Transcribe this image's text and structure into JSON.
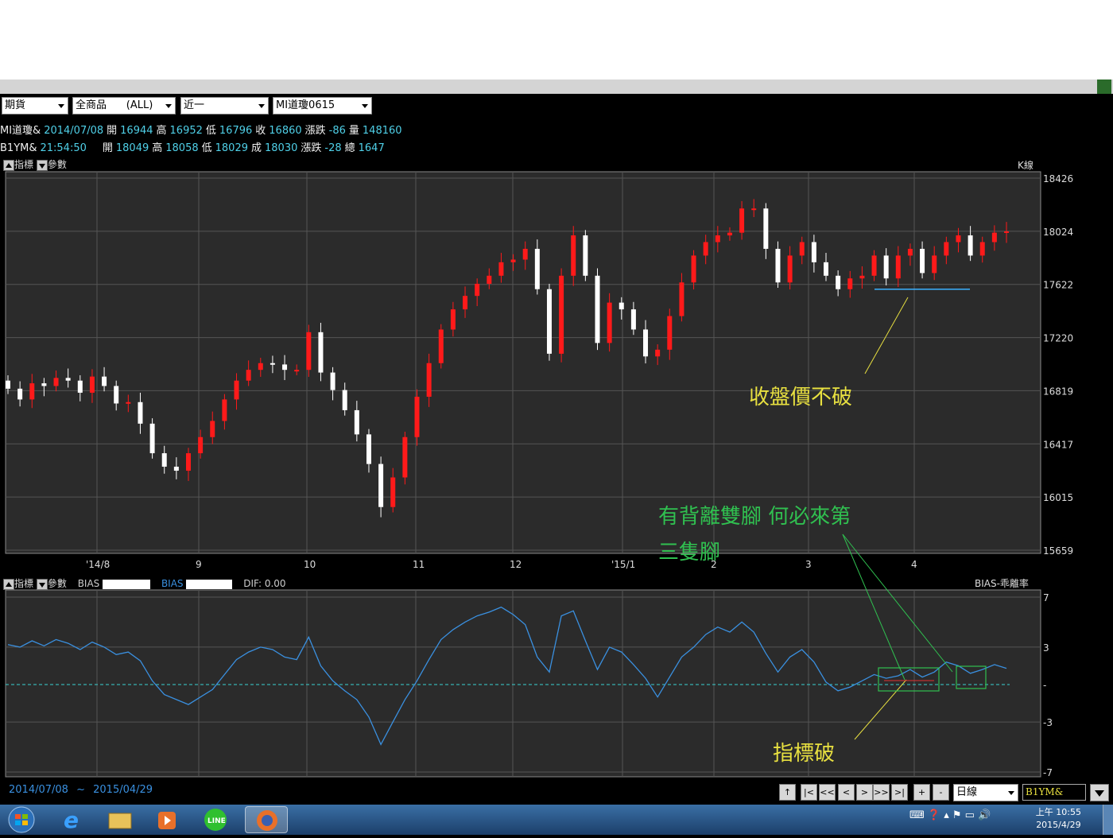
{
  "toolbar": {
    "combo1": "期貨",
    "combo2": "全商品      (ALL)",
    "combo3": "近一",
    "combo4": "MI道瓊0615"
  },
  "quote1": {
    "name": "MI道瓊&",
    "date": "2014/07/08",
    "open_label": "開",
    "open": "16944",
    "high_label": "高",
    "high": "16952",
    "low_label": "低",
    "low": "16796",
    "close_label": "收",
    "close": "16860",
    "chg_label": "漲跌",
    "chg": "-86",
    "vol_label": "量",
    "vol": "148160"
  },
  "quote2": {
    "name": "B1YM&",
    "time": "21:54:50",
    "open_label": "開",
    "open": "18049",
    "high_label": "高",
    "high": "18058",
    "low_label": "低",
    "low": "18029",
    "close_label": "成",
    "close": "18030",
    "chg_label": "漲跌",
    "chg": "-28",
    "vol_label": "總",
    "vol": "1647"
  },
  "panel1": {
    "ind_label": "指標",
    "param_label": "參數",
    "right_label": "K線"
  },
  "panel2": {
    "ind_label": "指標",
    "param_label": "參數",
    "bias1_label": "BIAS",
    "bias2_label": "BIAS",
    "dif_label": "DIF:",
    "dif_value": "0.00",
    "right_label": "BIAS-乖離率"
  },
  "chart_data": [
    {
      "type": "candlestick",
      "yticks": [
        "18426",
        "18024",
        "17622",
        "17220",
        "16819",
        "16417",
        "16015",
        "15659"
      ],
      "ylim": [
        15659,
        18426
      ],
      "xticks": [
        "'14/8",
        "9",
        "10",
        "11",
        "12",
        "'15/1",
        "2",
        "3",
        "4"
      ],
      "support_line": 17600,
      "annotations": [
        "收盤價不破"
      ],
      "colors": {
        "up": "#ff1a1a",
        "down": "#ffffff"
      }
    },
    {
      "type": "line",
      "series": [
        {
          "values": [
            3.2,
            3.0,
            3.5,
            3.1,
            3.6,
            3.3,
            2.8,
            3.4,
            3.0,
            2.4,
            2.6,
            1.9,
            0.3,
            -0.8,
            -1.2,
            -1.6,
            -1.0,
            -0.4,
            0.8,
            2.0,
            2.6,
            3.0,
            2.8,
            2.2,
            2.0,
            3.8,
            1.5,
            0.3,
            -0.5,
            -1.2,
            -2.6,
            -4.8,
            -3.0,
            -1.2,
            0.3,
            2.0,
            3.6,
            4.4,
            5.0,
            5.5,
            5.8,
            6.2,
            5.6,
            4.8,
            2.2,
            1.0,
            5.5,
            5.9,
            3.5,
            1.2,
            3.0,
            2.6,
            1.6,
            0.5,
            -1.0,
            0.6,
            2.2,
            3.0,
            4.0,
            4.6,
            4.2,
            5.0,
            4.2,
            2.5,
            1.0,
            2.2,
            2.8,
            1.8,
            0.2,
            -0.5,
            -0.2,
            0.3,
            0.8,
            0.5,
            0.7,
            1.2,
            0.6,
            1.0,
            1.8,
            1.5,
            0.9,
            1.2,
            1.6,
            1.3
          ],
          "color": "#3a90e0"
        }
      ],
      "yticks": [
        "7",
        "3",
        "-",
        "-3",
        "-7"
      ],
      "ylim": [
        -7,
        7
      ],
      "annotations": [
        "有背離雙腳 何必來第三隻腳",
        "指標破"
      ]
    }
  ],
  "footer": {
    "date_from": "2014/07/08",
    "tilde": "~",
    "date_to": "2015/04/29",
    "period": "日線",
    "symbol": "B1YM&",
    "nav": [
      "↑",
      "|<",
      "<<",
      "<",
      ">",
      ">>",
      ">|",
      "+",
      "-"
    ]
  },
  "taskbar": {
    "time": "上午 10:55",
    "date": "2015/4/29"
  }
}
